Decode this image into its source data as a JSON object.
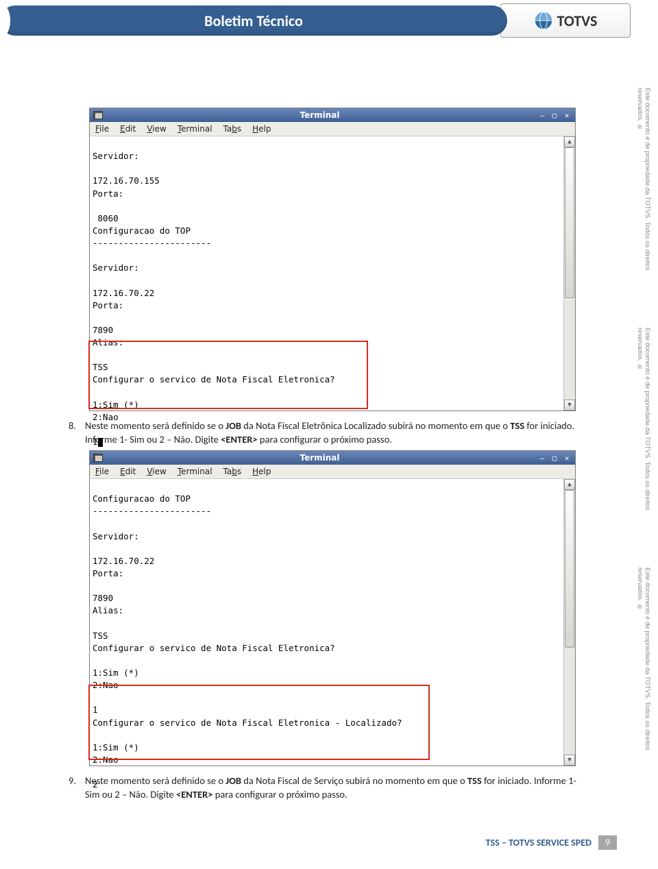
{
  "header": {
    "title": "Boletim Técnico",
    "brand": "TOTVS"
  },
  "watermark": "Este documento é de propriedade da TOTVS. Todos os direitos reservados. ®",
  "steps": {
    "s8": {
      "num": "8.",
      "text_a": "Neste momento será definido se o ",
      "job": "JOB",
      "text_b": " da Nota Fiscal Eletrônica Localizado subirá no momento em que o ",
      "tss": "TSS",
      "text_c": " for iniciado. Informe 1- Sim ou 2 – Não. Digite ",
      "enter": "<ENTER>",
      "text_d": " para configurar o próximo passo."
    },
    "s9": {
      "num": "9.",
      "text_a": "Neste momento será definido se o ",
      "job": "JOB",
      "text_b": " da Nota Fiscal de Serviço subirá no momento em que o ",
      "tss": "TSS",
      "text_c": " for iniciado. Informe 1- Sim ou 2 – Não. Digite ",
      "enter": "<ENTER>",
      "text_d": " para configurar o próximo passo."
    }
  },
  "terminal": {
    "title": "Terminal",
    "menu": [
      "File",
      "Edit",
      "View",
      "Terminal",
      "Tabs",
      "Help"
    ],
    "body1": "Servidor:\n\n172.16.70.155\nPorta:\n\n 8060\nConfiguracao do TOP\n-----------------------\n\nServidor:\n\n172.16.70.22\nPorta:\n\n7890\nAlias:\n\nTSS\nConfigurar o servico de Nota Fiscal Eletronica?\n\n1:Sim (*)\n2:Nao\n\n1",
    "body2": "Configuracao do TOP\n-----------------------\n\nServidor:\n\n172.16.70.22\nPorta:\n\n7890\nAlias:\n\nTSS\nConfigurar o servico de Nota Fiscal Eletronica?\n\n1:Sim (*)\n2:Nao\n\n1\nConfigurar o servico de Nota Fiscal Eletronica - Localizado?\n\n1:Sim (*)\n2:Nao\n\n2"
  },
  "footer": {
    "label": "TSS – TOTVS SERVICE SPED",
    "page": "9"
  }
}
